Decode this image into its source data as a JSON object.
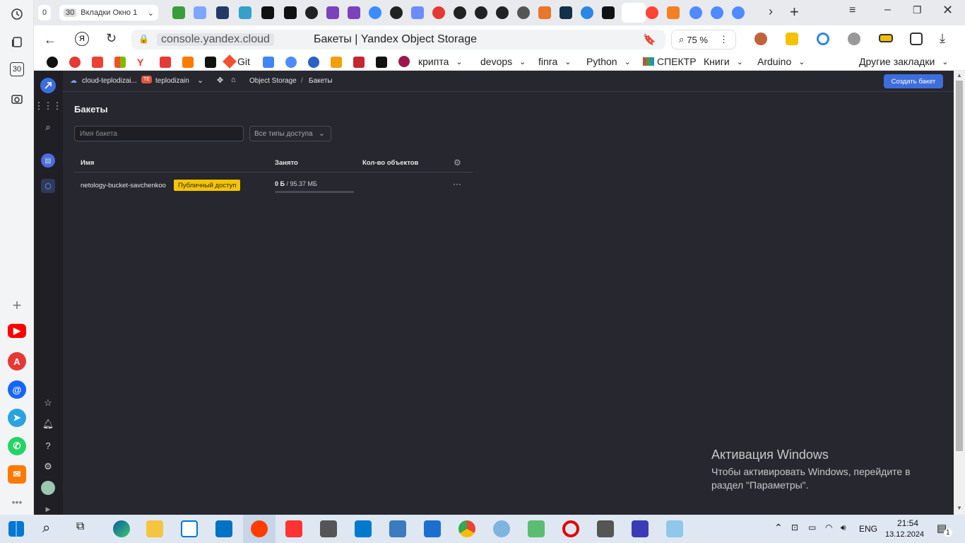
{
  "browser": {
    "tab_group_count": "0",
    "tab_count_badge": "30",
    "tab_group_title": "Вкладки Окно 1",
    "url": "console.yandex.cloud",
    "page_title": "Бакеты | Yandex Object Storage",
    "zoom": "75 %",
    "sidebar_badge": "30"
  },
  "bookmarks": {
    "items": [
      "Git",
      "крипта",
      "devops",
      "finra",
      "Python",
      "СПЕКТР",
      "Книги",
      "Arduino",
      "Другие закладки"
    ]
  },
  "console": {
    "breadcrumb": {
      "cloud": "cloud-teplodizai...",
      "folder_badge": "TE",
      "folder": "teplodizain",
      "service": "Object Storage",
      "page": "Бакеты"
    },
    "create_button": "Создать бакет",
    "page_title": "Бакеты",
    "filter_placeholder": "Имя бакета",
    "access_filter": "Все типы доступа",
    "table": {
      "headers": [
        "Имя",
        "Занято",
        "Кол-во объектов"
      ],
      "rows": [
        {
          "name": "netology-bucket-savchenkoo",
          "access": "Публичный доступ",
          "used": "0 Б",
          "quota": "/ 95.37 МБ",
          "used_fraction": 0,
          "objects": ""
        }
      ],
      "row_menu": "···"
    }
  },
  "windows_activation": {
    "title": "Активация Windows",
    "line1": "Чтобы активировать Windows, перейдите в",
    "line2": "раздел \"Параметры\"."
  },
  "taskbar": {
    "lang": "ENG",
    "time": "21:54",
    "date": "13.12.2024",
    "notifications": "1"
  },
  "colors": {
    "console_bg": "#27272f",
    "accent_button": "#3d6edb",
    "public_badge": "#f6c400"
  }
}
